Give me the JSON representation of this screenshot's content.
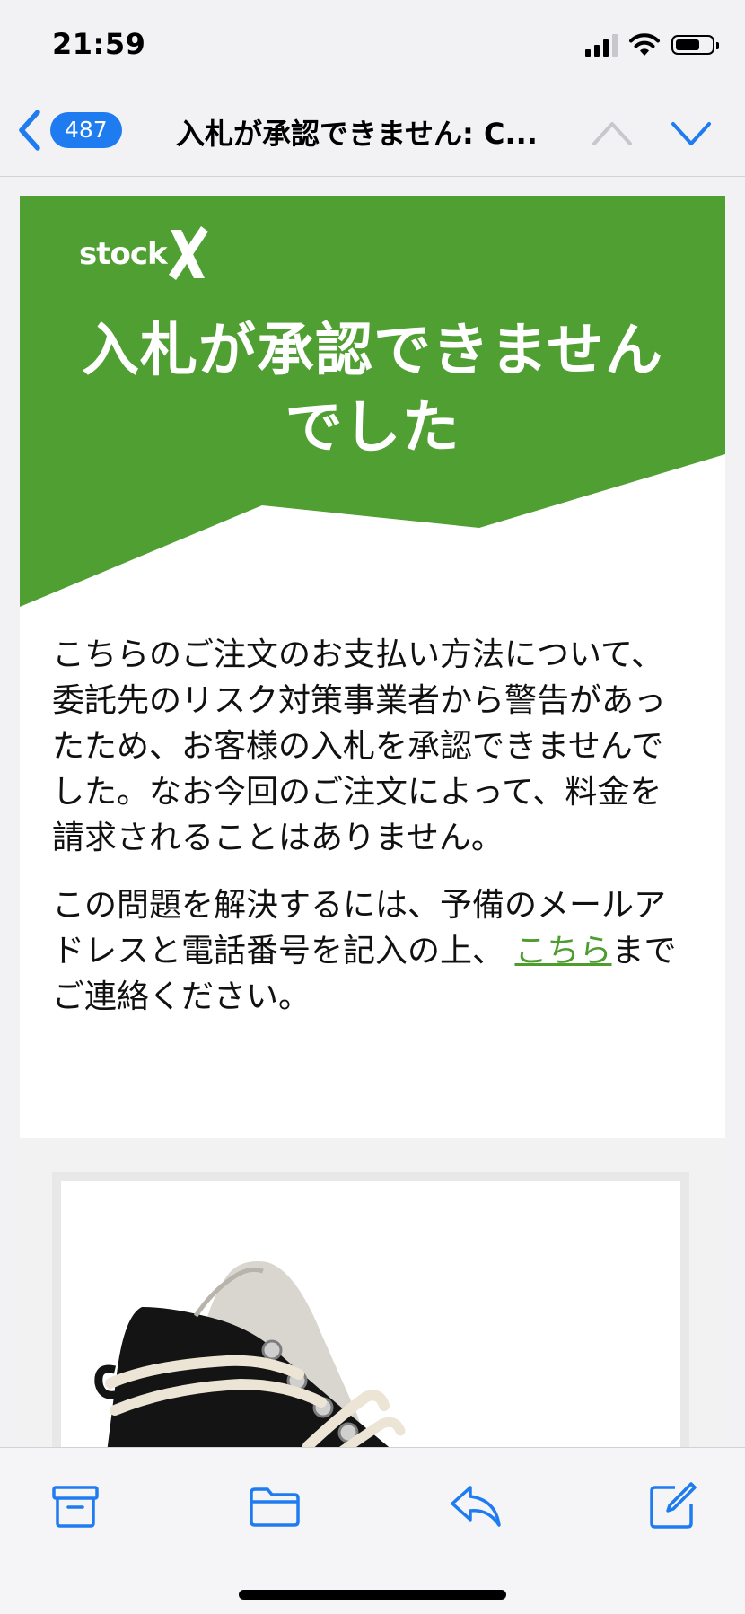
{
  "status_bar": {
    "time": "21:59"
  },
  "nav": {
    "unread_count": "487",
    "title": "入札が承認できません: C..."
  },
  "email": {
    "brand": "stock",
    "headline_line1": "入札が承認できません",
    "headline_line2": "でした",
    "paragraph1": "こちらのご注文のお支払い方法について、委託先のリスク対策事業者から警告があったため、お客様の入札を承認できませんでした。なお今回のご注文によって、料金を請求されることはありません。",
    "paragraph2_before_link": "この問題を解決するには、予備のメールアドレスと電話番号を記入の上、",
    "paragraph2_link": "こちら",
    "paragraph2_after_link": "までご連絡ください。"
  },
  "colors": {
    "brand_green": "#4f9f32",
    "link_green": "#4c9c2e",
    "ios_blue": "#1e7cf0"
  },
  "icons": {
    "back": "chevron-left-icon",
    "up": "chevron-up-icon",
    "down": "chevron-down-icon",
    "archive": "archive-icon",
    "folder": "folder-icon",
    "reply": "reply-icon",
    "compose": "compose-icon"
  }
}
